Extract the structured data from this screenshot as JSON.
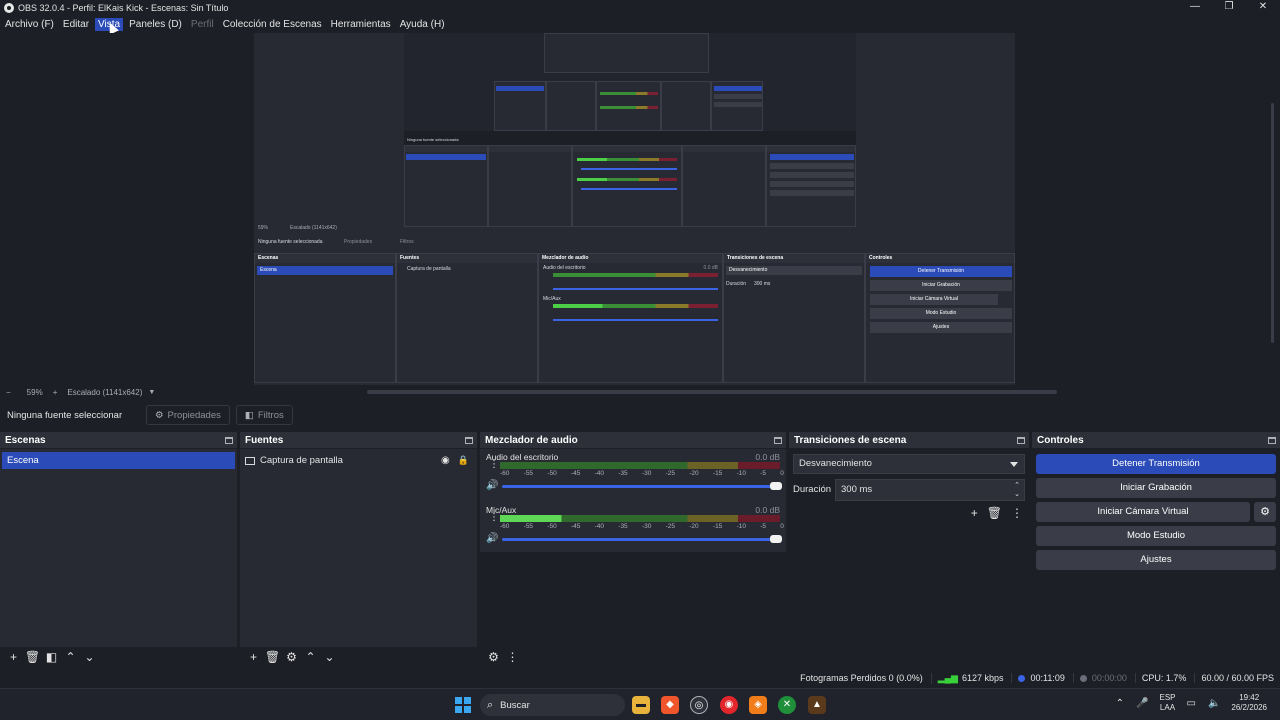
{
  "window": {
    "title": "OBS 32.0.4 - Perfil: ElKais Kick - Escenas: Sin Título",
    "minimize": "—",
    "maximize": "❐",
    "close": "✕"
  },
  "menu": [
    "Archivo (F)",
    "Editar",
    "Vista",
    "Paneles (D)",
    "Perfil",
    "Colección de Escenas",
    "Herramientas",
    "Ayuda (H)"
  ],
  "nested": {
    "no_source": "Ninguna fuente seleccionada",
    "props": "Propiedades",
    "filters": "Filtros",
    "zoom": "59%",
    "scale": "Escalado (1141x642)",
    "scenes": "Escenas",
    "scene": "Escena",
    "sources": "Fuentes",
    "source": "Captura de pantalla",
    "mixer": "Mezclador de audio",
    "ch1": "Audio del escritorio",
    "ch2": "Mic/Aux",
    "db": "0.0 dB",
    "trans": "Transiciones de escena",
    "fade": "Desvanecimiento",
    "dur_label": "Duración",
    "dur": "300 ms",
    "controls": "Controles",
    "stop": "Detener Transmisión",
    "rec": "Iniciar Grabación",
    "vcam": "Iniciar Cámara Virtual",
    "studio": "Modo Estudio",
    "settings": "Ajustes"
  },
  "zoombar": {
    "minus": "−",
    "zoom": "59%",
    "plus": "+",
    "scale": "Escalado (1141x642)"
  },
  "sourcebar": {
    "no_source": "Ninguna fuente seleccionar",
    "properties": "Propiedades",
    "filters": "Filtros"
  },
  "scenes": {
    "title": "Escenas",
    "items": [
      "Escena"
    ]
  },
  "sources": {
    "title": "Fuentes",
    "items": [
      "Captura de pantalla"
    ]
  },
  "mixer": {
    "title": "Mezclador de audio",
    "ticks": [
      "-60",
      "-55",
      "-50",
      "-45",
      "-40",
      "-35",
      "-30",
      "-25",
      "-20",
      "-15",
      "-10",
      "-5",
      "0"
    ],
    "channels": [
      {
        "name": "Audio del escritorio",
        "db": "0.0 dB",
        "level": 0.0
      },
      {
        "name": "Mic/Aux",
        "db": "0.0 dB",
        "level": 0.22
      }
    ]
  },
  "transitions": {
    "title": "Transiciones de escena",
    "selected": "Desvanecimiento",
    "duration_label": "Duración",
    "duration": "300 ms"
  },
  "controls": {
    "title": "Controles",
    "stop_stream": "Detener Transmisión",
    "start_recording": "Iniciar Grabación",
    "start_virtual_cam": "Iniciar Cámara Virtual",
    "studio_mode": "Modo Estudio",
    "settings": "Ajustes"
  },
  "status": {
    "dropped_frames": "Fotogramas Perdidos 0 (0.0%)",
    "bitrate": "6127 kbps",
    "stream_time": "00:11:09",
    "record_time": "00:00:00",
    "cpu": "CPU: 1.7%",
    "fps": "60.00 / 60.00 FPS"
  },
  "taskbar": {
    "search": "Buscar",
    "lang_top": "ESP",
    "lang_bottom": "LAA",
    "time": "19:42",
    "date": "26/2/2026"
  },
  "colors": {
    "accent": "#2a4bb8",
    "bg": "#1d1f26",
    "panel": "#272a33",
    "meter_green": "#5fd655"
  }
}
